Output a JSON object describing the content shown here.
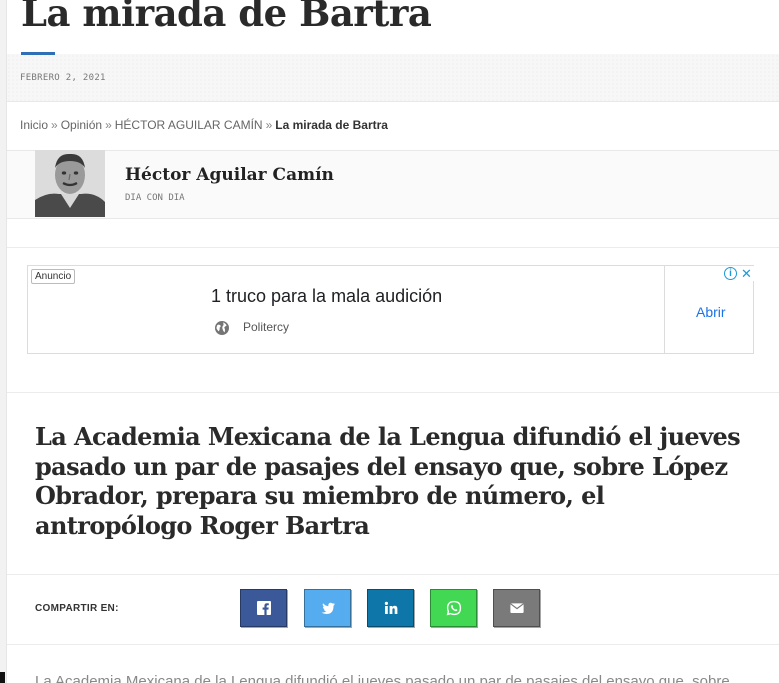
{
  "article": {
    "title": "La mirada de Bartra",
    "date": "FEBRERO 2, 2021",
    "lead": "La Academia Mexicana de la Lengua difundió el jueves pasado un par de pasajes del ensayo que, sobre López Obrador, prepara su miembro de número, el antropólogo Roger Bartra",
    "body_first_line": "La Academia Mexicana de la Lengua difundió el jueves pasado un par de pasajes del ensayo que, sobre"
  },
  "breadcrumb": {
    "items": [
      "Inicio",
      "Opinión",
      "HÉCTOR AGUILAR CAMÍN"
    ],
    "separator": "»",
    "current": "La mirada de Bartra"
  },
  "author": {
    "name": "Héctor Aguilar Camín",
    "column": "DIA CON DIA"
  },
  "ad": {
    "label": "Anuncio",
    "headline": "1 truco para la mala audición",
    "source": "Politercy",
    "cta": "Abrir",
    "info_icon": "info-icon",
    "close_icon": "close-icon"
  },
  "share": {
    "label": "COMPARTIR EN:",
    "buttons": [
      {
        "network": "facebook",
        "icon": "facebook-icon",
        "color": "#3b5998"
      },
      {
        "network": "twitter",
        "icon": "twitter-icon",
        "color": "#55acee"
      },
      {
        "network": "linkedin",
        "icon": "linkedin-icon",
        "color": "#0e76a8"
      },
      {
        "network": "whatsapp",
        "icon": "whatsapp-icon",
        "color": "#43d854"
      },
      {
        "network": "email",
        "icon": "email-icon",
        "color": "#7a7a7a"
      }
    ]
  },
  "colors": {
    "accent": "#2f6fb5",
    "ad_cta": "#1a73e8"
  }
}
